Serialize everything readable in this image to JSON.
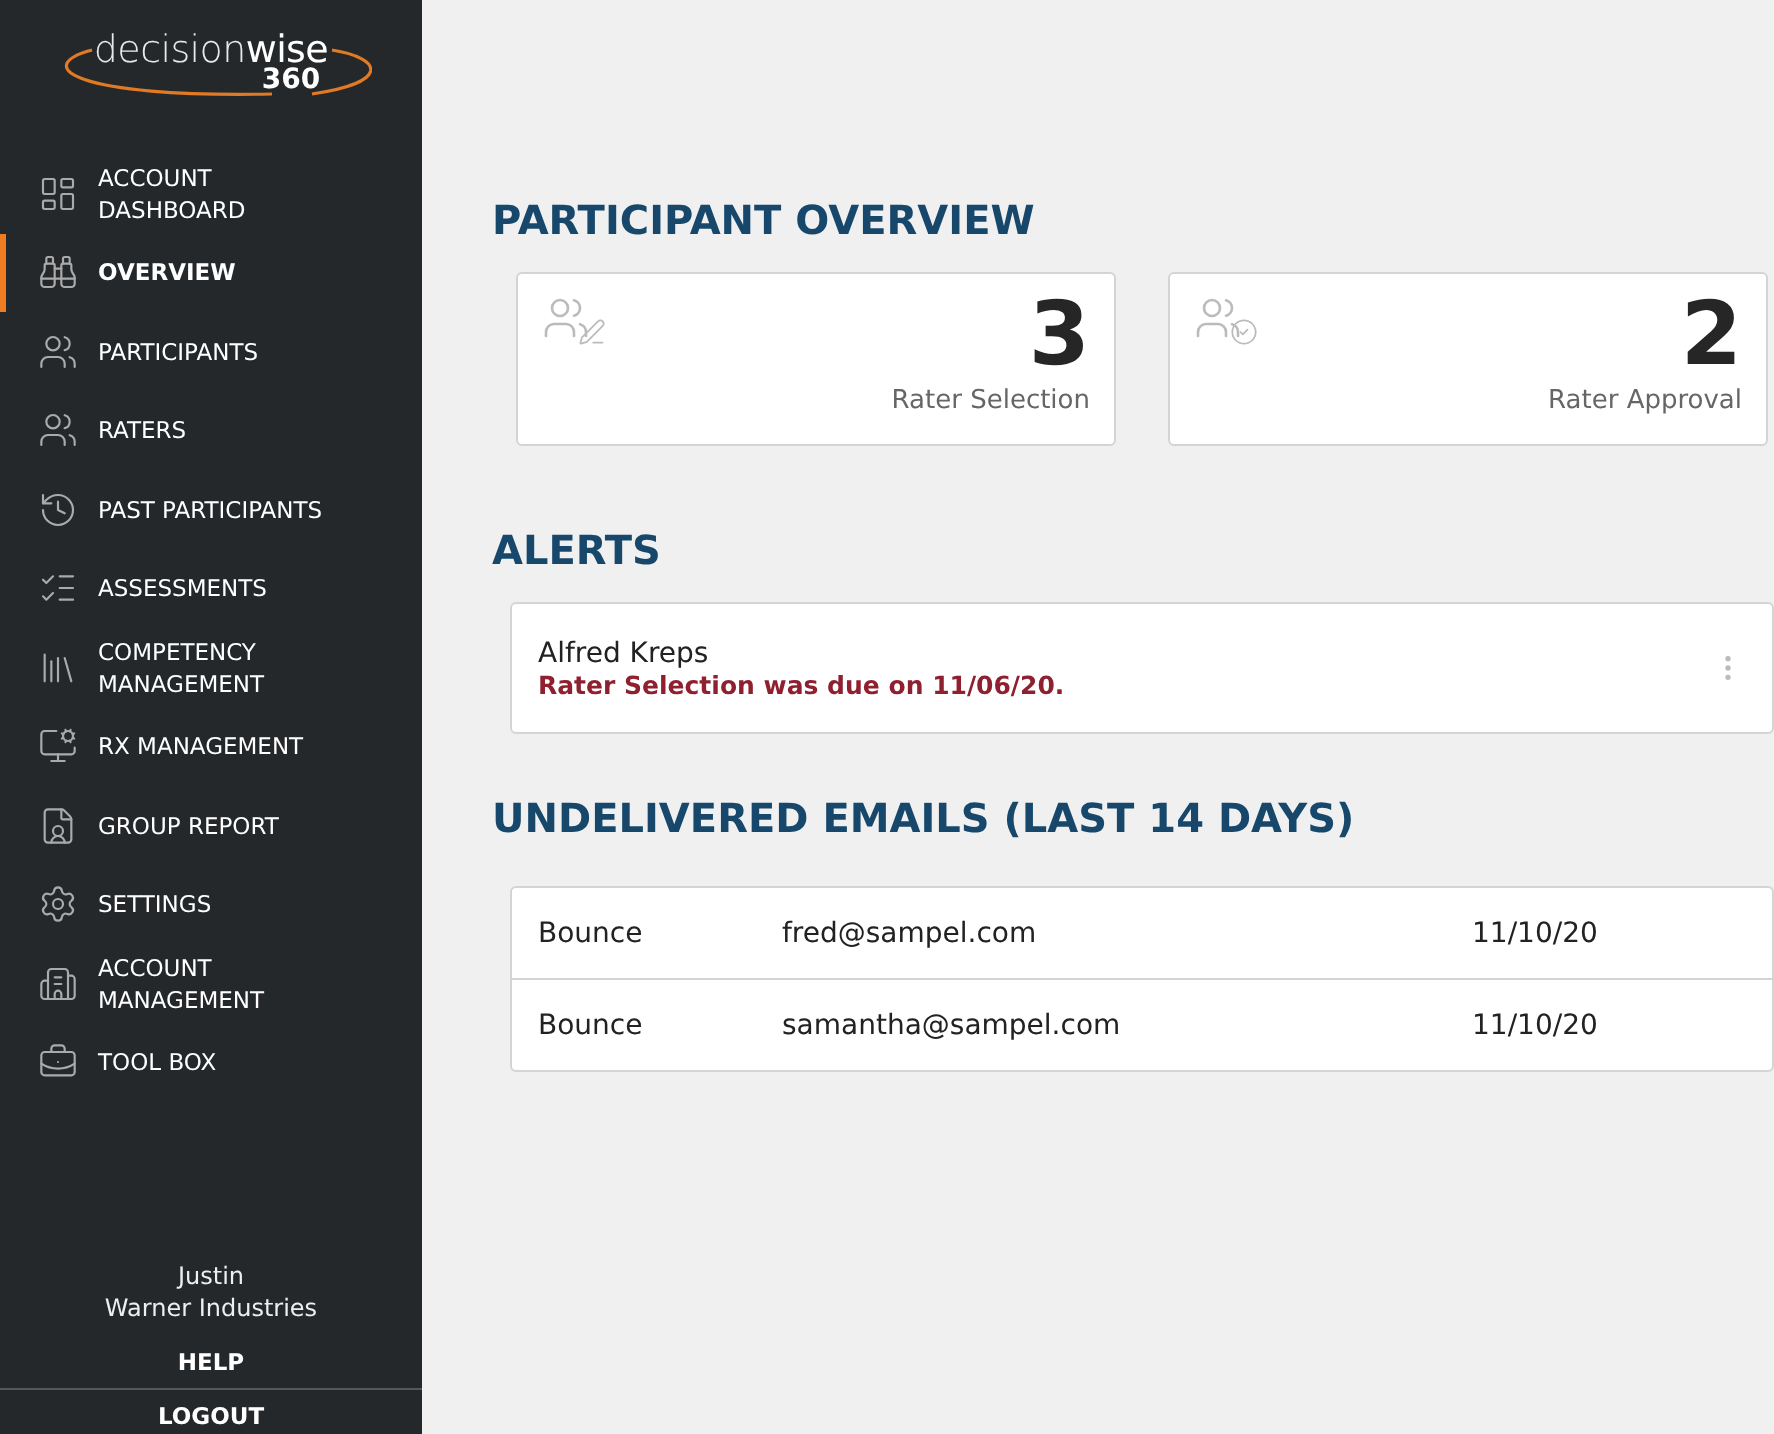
{
  "logo": {
    "main": "decision",
    "bold": "wise",
    "sub": "360"
  },
  "nav": [
    {
      "label": "ACCOUNT DASHBOARD",
      "selected": false
    },
    {
      "label": "OVERVIEW",
      "selected": true
    },
    {
      "label": "PARTICIPANTS",
      "selected": false
    },
    {
      "label": "RATERS",
      "selected": false
    },
    {
      "label": "PAST PARTICIPANTS",
      "selected": false
    },
    {
      "label": "ASSESSMENTS",
      "selected": false
    },
    {
      "label": "COMPETENCY MANAGEMENT",
      "selected": false
    },
    {
      "label": "RX MANAGEMENT",
      "selected": false
    },
    {
      "label": "GROUP REPORT",
      "selected": false
    },
    {
      "label": "SETTINGS",
      "selected": false
    },
    {
      "label": "ACCOUNT MANAGEMENT",
      "selected": false
    },
    {
      "label": "TOOL BOX",
      "selected": false
    }
  ],
  "user": {
    "name": "Justin",
    "company": "Warner Industries"
  },
  "help": "HELP",
  "logout": "LOGOUT",
  "overview": {
    "title": "PARTICIPANT OVERVIEW",
    "cards": [
      {
        "kind": "edit",
        "count": "3",
        "label": "Rater Selection"
      },
      {
        "kind": "approve",
        "count": "2",
        "label": "Rater Approval"
      }
    ]
  },
  "alerts": {
    "title": "ALERTS",
    "items": [
      {
        "name": "Alfred Kreps",
        "message": "Rater Selection was due on 11/06/20."
      }
    ]
  },
  "emails": {
    "title": "UNDELIVERED EMAILS (LAST 14 DAYS)",
    "rows": [
      {
        "status": "Bounce",
        "email": "fred@sampel.com",
        "date": "11/10/20"
      },
      {
        "status": "Bounce",
        "email": "samantha@sampel.com",
        "date": "11/10/20"
      }
    ]
  }
}
